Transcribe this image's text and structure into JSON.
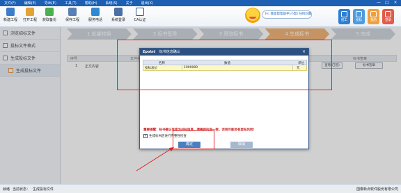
{
  "menu": [
    "文件(F)",
    "编辑(E)",
    "导出(E)",
    "工具(T)",
    "帮助(H)",
    "系统(S)",
    "关于",
    "退出(X)"
  ],
  "window_controls": [
    "—",
    "□",
    "×"
  ],
  "toolbar": {
    "buttons": [
      {
        "label": "新建工程",
        "icon": "new-project-icon",
        "color": "#3f7cc8"
      },
      {
        "label": "打开工程",
        "icon": "open-project-icon",
        "color": "#e3a236"
      },
      {
        "label": "获取备份",
        "icon": "backup-icon",
        "color": "#4caf50"
      },
      {
        "label": "保存工程",
        "icon": "save-project-icon",
        "color": "#5b7fb2"
      },
      {
        "label": "服务电话",
        "icon": "phone-icon",
        "color": "#2f8bd1"
      },
      {
        "label": "系统登录",
        "icon": "login-icon",
        "color": "#4a6fa5"
      },
      {
        "label": "CA认证",
        "icon": "ca-lock-icon",
        "color": "#2b5183"
      }
    ],
    "assistant_text": "Hi, 我是帮帮助手(小帮) 任何问题",
    "right_buttons": [
      {
        "label": "招工",
        "color": "#2f7fd1"
      },
      {
        "label": "投标",
        "color": "#4f9be0"
      },
      {
        "label": "我的",
        "color": "#f2a03c"
      },
      {
        "label": "登录",
        "color": "#e25b4a"
      }
    ]
  },
  "sidebar": {
    "items": [
      {
        "label": "浏览招标文件"
      },
      {
        "label": "投标文件格式"
      },
      {
        "label": "生成投标文件"
      },
      {
        "label": "生成投标文件",
        "sub": true
      }
    ]
  },
  "steps": [
    {
      "num": "1",
      "label": "批量转换"
    },
    {
      "num": "2",
      "label": "标书签章"
    },
    {
      "num": "3",
      "label": "预览标书"
    },
    {
      "num": "4",
      "label": "生成标书",
      "active": true
    },
    {
      "num": "5",
      "label": "完成"
    }
  ],
  "grid": {
    "headers": [
      "序号",
      "文件名称",
      "标书签章"
    ],
    "row": {
      "index": "1",
      "name": "正文内容",
      "btn1": "查看(已签)",
      "btn2": "标书签章"
    }
  },
  "dialog": {
    "logo": "Epoint",
    "title": "标书信息确认",
    "close": "×",
    "table_headers": [
      "名称",
      "数值",
      "单位"
    ],
    "row": {
      "name": "投标总价",
      "value": "1000000",
      "unit": "元"
    },
    "warning": "重要提醒：标书确认信息为开标信息，请确保内容一致，否则可能会有废标风险！",
    "confirm_label": "生成标书后进行完整性检查",
    "ok_label": "确定",
    "cancel_label": "取消"
  },
  "status": {
    "ready": "就绪",
    "current_label": "当前状态：",
    "current_value": "生成投标文件",
    "company": "国泰新点软件股份有限公司"
  },
  "colors": {
    "menubar": "#1c5fb3",
    "dialog_title": "#2b5183",
    "annotation": "#e02020",
    "step_active": "#f0a35a"
  }
}
